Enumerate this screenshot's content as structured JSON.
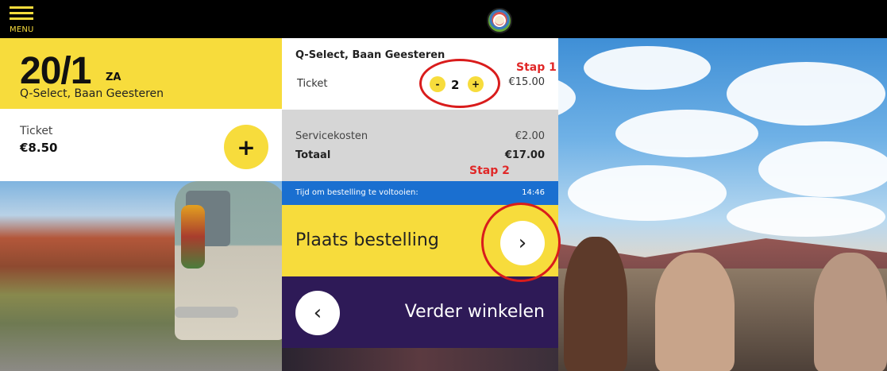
{
  "header": {
    "menu_label": "MENU"
  },
  "event": {
    "date": "20/1",
    "day": "ZA",
    "venue": "Q-Select, Baan Geesteren"
  },
  "ticket_offer": {
    "label": "Ticket",
    "price": "€8.50",
    "add_symbol": "+"
  },
  "order": {
    "title": "Q-Select, Baan Geesteren",
    "ticket_label": "Ticket",
    "quantity": "2",
    "minus_symbol": "-",
    "plus_symbol": "+",
    "line_price": "€15.00",
    "service_label": "Servicekosten",
    "service_value": "€2.00",
    "total_label": "Totaal",
    "total_value": "€17.00"
  },
  "timer": {
    "label": "Tijd om bestelling te voltooien:",
    "value": "14:46"
  },
  "actions": {
    "place_order_label": "Plaats bestelling",
    "place_order_arrow": "›",
    "continue_label": "Verder winkelen",
    "continue_arrow": "‹"
  },
  "annotations": {
    "step1": "Stap 1",
    "step2": "Stap 2"
  },
  "colors": {
    "accent_yellow": "#f7dc3c",
    "timer_blue": "#1a6fd0",
    "continue_purple": "#2e1a57",
    "annotation_red": "#d91c1c"
  }
}
